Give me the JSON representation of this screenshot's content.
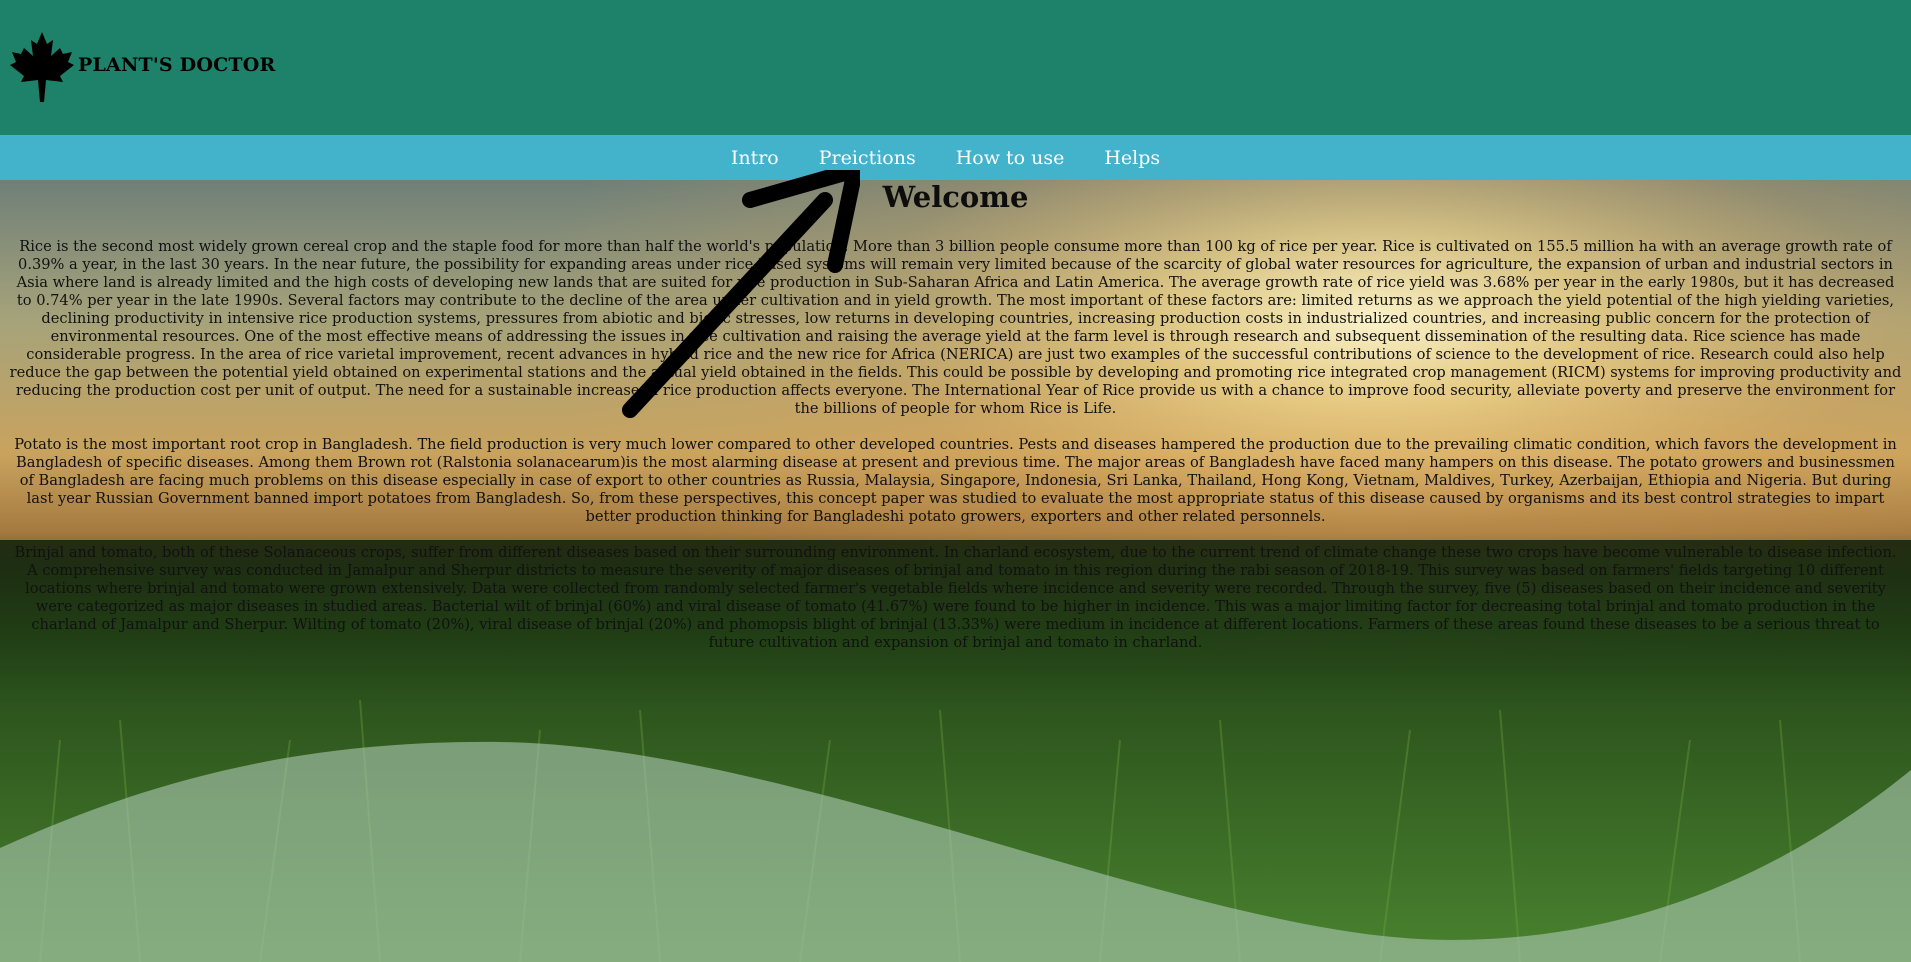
{
  "brand": {
    "name": "PLANT'S DOCTOR",
    "logo_icon": "maple-leaf-icon"
  },
  "nav": {
    "items": [
      "Intro",
      "Preictions",
      "How to use",
      "Helps"
    ]
  },
  "main": {
    "title": "Welcome",
    "paragraphs": [
      "Rice is the second most widely grown cereal crop and the staple food for more than half the world's population. More than 3 billion people consume more than 100 kg of rice per year. Rice is cultivated on 155.5 million ha with an average growth rate of 0.39% a year, in the last 30 years. In the near future, the possibility for expanding areas under rice-based systems will remain very limited because of the scarcity of global water resources for agriculture, the expansion of urban and industrial sectors in Asia where land is already limited and the high costs of developing new lands that are suited for rice production in Sub-Saharan Africa and Latin America. The average growth rate of rice yield was 3.68% per year in the early 1980s, but it has decreased to 0.74% per year in the late 1990s. Several factors may contribute to the decline of the area under cultivation and in yield growth. The most important of these factors are: limited returns as we approach the yield potential of the high yielding varieties, declining productivity in intensive rice production systems, pressures from abiotic and biotic stresses, low returns in developing countries, increasing production costs in industrialized countries, and increasing public concern for the protection of environmental resources. One of the most effective means of addressing the issues in rice cultivation and raising the average yield at the farm level is through research and subsequent dissemination of the resulting data. Rice science has made considerable progress. In the area of rice varietal improvement, recent advances in hybrid rice and the new rice for Africa (NERICA) are just two examples of the successful contributions of science to the development of rice. Research could also help reduce the gap between the potential yield obtained on experimental stations and the actual yield obtained in the fields. This could be possible by developing and promoting rice integrated crop management (RICM) systems for improving productivity and reducing the production cost per unit of output. The need for a sustainable increase in rice production affects everyone. The International Year of Rice provide us with a chance to improve food security, alleviate poverty and preserve the environment for the billions of people for whom Rice is Life.",
      "Potato is the most important root crop in Bangladesh. The field production is very much lower compared to other developed countries. Pests and diseases hampered the production due to the prevailing climatic condition, which favors the development in Bangladesh of specific diseases. Among them Brown rot (Ralstonia solanacearum)is the most alarming disease at present and previous time. The major areas of Bangladesh have faced many hampers on this disease. The potato growers and businessmen of Bangladesh are facing much problems on this disease especially in case of export to other countries as Russia, Malaysia, Singapore, Indonesia, Sri Lanka, Thailand, Hong Kong, Vietnam, Maldives, Turkey, Azerbaijan, Ethiopia and Nigeria. But during last year Russian Government banned import potatoes from Bangladesh. So, from these perspectives, this concept paper was studied to evaluate the most appropriate status of this disease caused by organisms and its best control strategies to impart better production thinking for Bangladeshi potato growers, exporters and other related personnels.",
      "Brinjal and tomato, both of these Solanaceous crops, suffer from different diseases based on their surrounding environment. In charland ecosystem, due to the current trend of climate change these two crops have become vulnerable to disease infection. A comprehensive survey was conducted in Jamalpur and Sherpur districts to measure the severity of major diseases of brinjal and tomato in this region during the rabi season of 2018-19. This survey was based on farmers' fields targeting 10 different locations where brinjal and tomato were grown extensively. Data were collected from randomly selected farmer's vegetable fields where incidence and severity were recorded. Through the survey, five (5) diseases based on their incidence and severity were categorized as major diseases in studied areas. Bacterial wilt of brinjal (60%) and viral disease of tomato (41.67%) were found to be higher in incidence. This was a major limiting factor for decreasing total brinjal and tomato production in the charland of Jamalpur and Sherpur. Wilting of tomato (20%), viral disease of brinjal (20%) and phomopsis blight of brinjal (13.33%) were medium in incidence at different locations. Farmers of these areas found these diseases to be a serious threat to future cultivation and expansion of brinjal and tomato in charland."
    ]
  },
  "colors": {
    "header": "#1e816a",
    "navbar": "#43b2cb",
    "nav_text": "#ffffff"
  }
}
